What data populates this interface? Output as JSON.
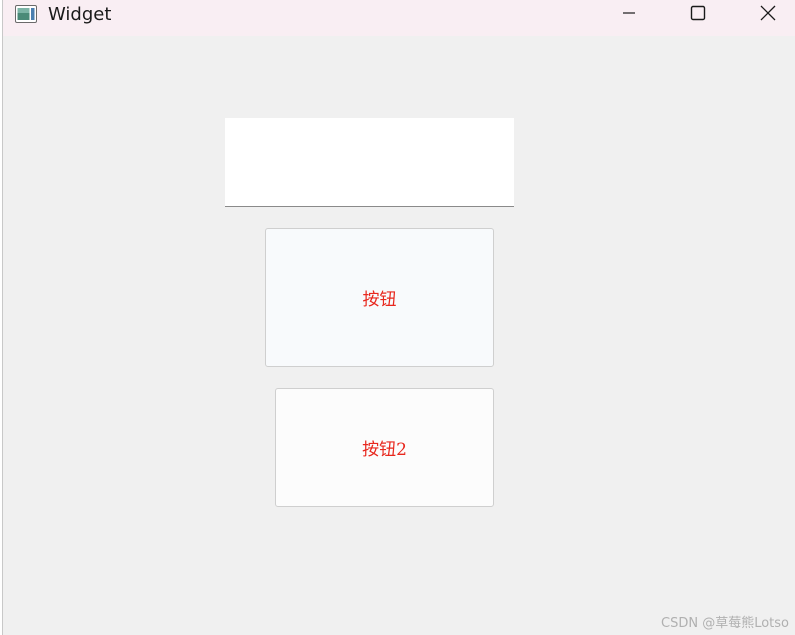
{
  "window": {
    "title": "Widget",
    "icon": "app-window-icon"
  },
  "titlebar": {
    "minimize_icon": "minimize-icon",
    "maximize_icon": "maximize-icon",
    "close_icon": "close-icon",
    "background": "#f9eef3"
  },
  "content": {
    "text_input": {
      "value": "",
      "placeholder": ""
    },
    "button1": {
      "label": "按钮",
      "color": "#e8281e"
    },
    "button2": {
      "label": "按钮2",
      "color": "#e8281e"
    }
  },
  "watermark": {
    "text": "CSDN @草莓熊Lotso"
  }
}
